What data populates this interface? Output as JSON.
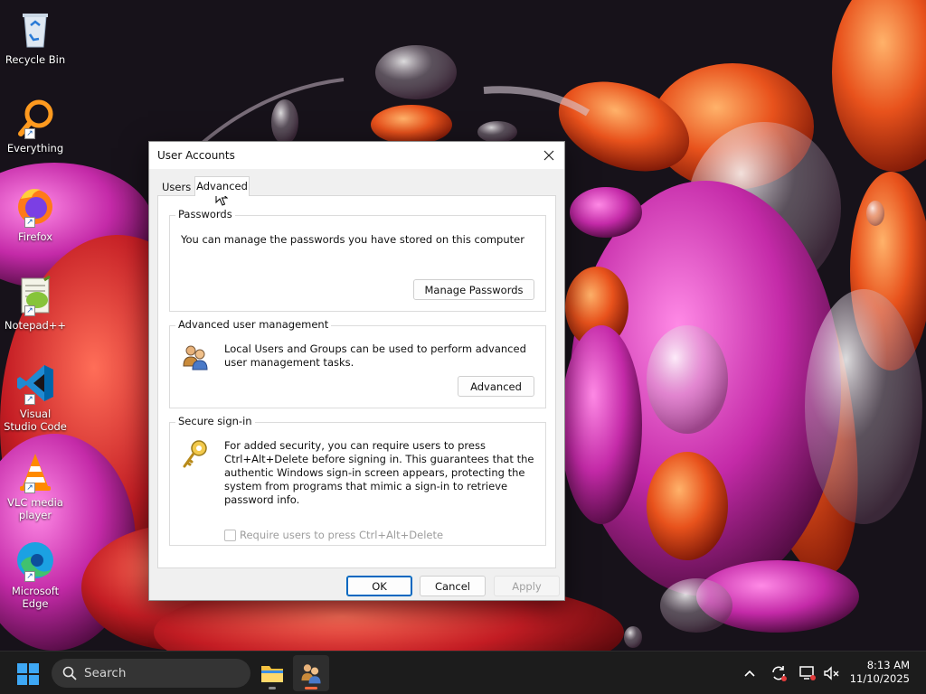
{
  "desktop": {
    "icons": [
      {
        "label": "Recycle Bin"
      },
      {
        "label": "Everything"
      },
      {
        "label": "Firefox"
      },
      {
        "label": "Notepad++"
      },
      {
        "label": "Visual Studio Code"
      },
      {
        "label": "VLC media player"
      },
      {
        "label": "Microsoft Edge"
      }
    ]
  },
  "dialog": {
    "title": "User Accounts",
    "tabs": [
      {
        "label": "Users"
      },
      {
        "label": "Advanced",
        "selected": true
      }
    ],
    "passwords": {
      "label": "Passwords",
      "text": "You can manage the passwords you have stored on this computer",
      "button": "Manage Passwords"
    },
    "advanced_mgmt": {
      "label": "Advanced user management",
      "text": "Local Users and Groups can be used to perform advanced user management tasks.",
      "button": "Advanced"
    },
    "secure_signin": {
      "label": "Secure sign-in",
      "text": "For added security, you can require users to press Ctrl+Alt+Delete before signing in. This guarantees that the authentic Windows sign-in screen appears, protecting the system from programs that mimic a sign-in to retrieve password info.",
      "checkbox_label": "Require users to press Ctrl+Alt+Delete",
      "checkbox_checked": false,
      "checkbox_enabled": false
    },
    "buttons": {
      "ok": "OK",
      "cancel": "Cancel",
      "apply": "Apply"
    }
  },
  "taskbar": {
    "search_placeholder": "Search",
    "time": "8:13 AM",
    "date": "11/10/2025"
  },
  "colors": {
    "accent": "#0067c0",
    "taskbar_bg": "#1c1c1c",
    "active_indicator": "#ff6a3d"
  }
}
